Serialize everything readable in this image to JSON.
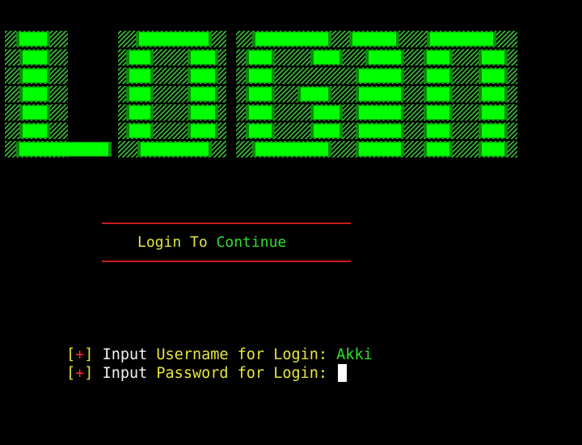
{
  "banner": {
    "text": "LOGIN",
    "color_bright": "#00ff00",
    "color_dark": "#0a8a0a"
  },
  "subtitle": {
    "part1": "Login To",
    "part2": "Continue"
  },
  "prompts": [
    {
      "bracket_open": "[",
      "marker": "+",
      "bracket_close": "]",
      "word1": "Input",
      "word2": "Username for Login:",
      "value": "Akki"
    },
    {
      "bracket_open": "[",
      "marker": "+",
      "bracket_close": "]",
      "word1": "Input",
      "word2": "Password for Login:",
      "value": ""
    }
  ],
  "colors": {
    "yellow": "#e6e63c",
    "green": "#2ee02e",
    "red": "#ff2a2a",
    "rule": "#c81e1e",
    "background": "#000000"
  }
}
